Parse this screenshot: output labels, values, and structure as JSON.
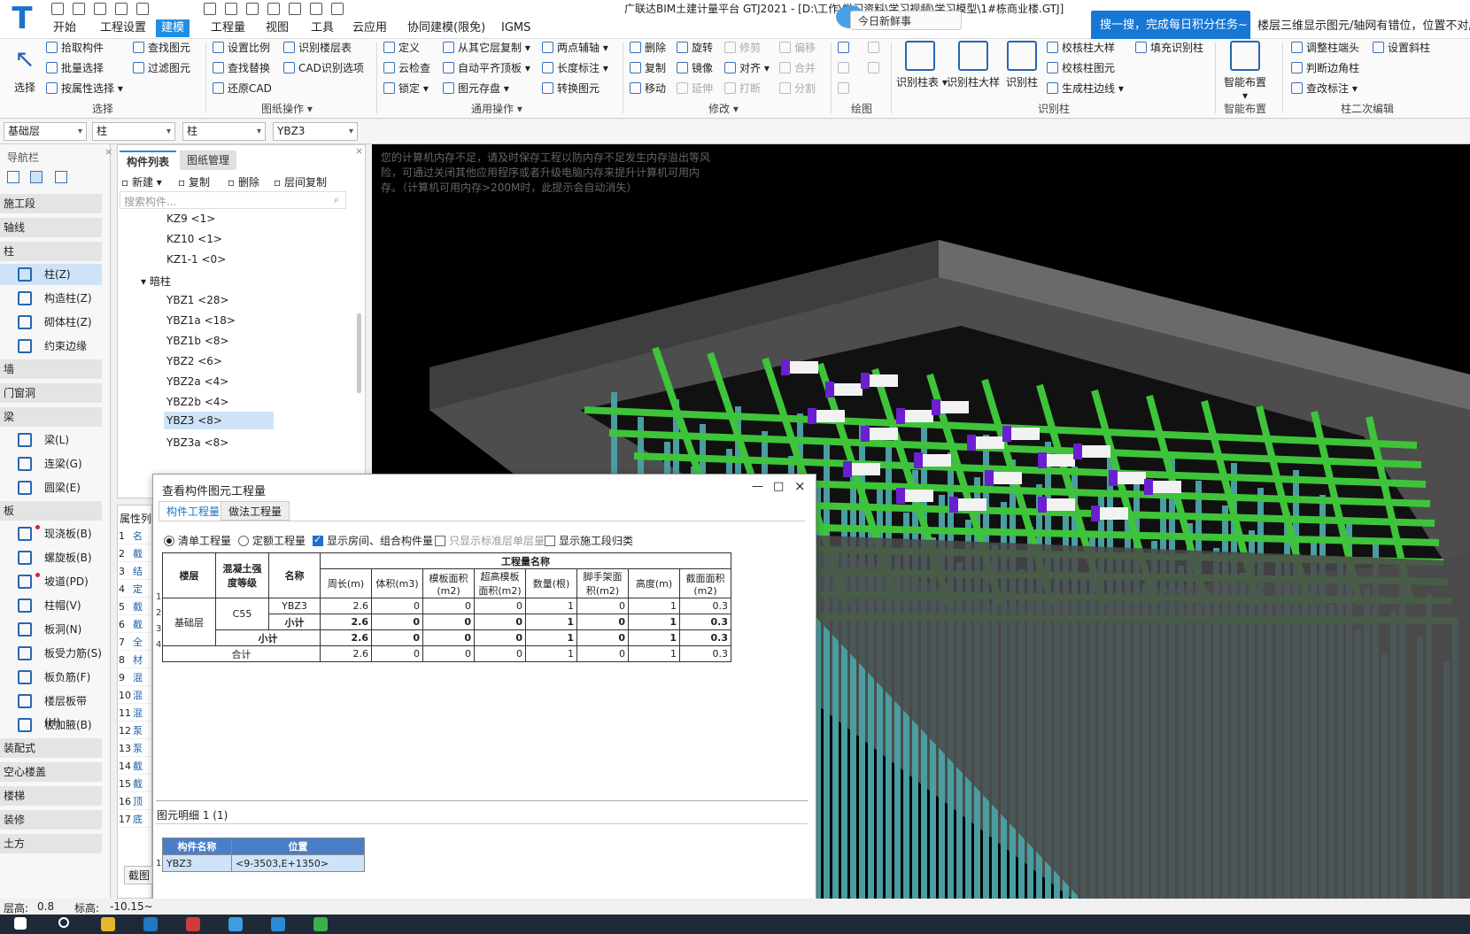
{
  "app": {
    "title": "广联达BIM土建计量平台 GTJ2021 - [D:\\工作\\学习资料\\学习视频\\学习模型\\1#栋商业楼.GTJ]",
    "news": "今日新鲜事",
    "promo": "搜一搜，完成每日积分任务~",
    "promo2": "楼层三维显示图元/轴网有错位，位置不对应"
  },
  "menu": [
    "开始",
    "工程设置",
    "建模",
    "工程量",
    "视图",
    "工具",
    "云应用",
    "协同建模(限免)",
    "IGMS"
  ],
  "ribbon": {
    "select_big": "选择",
    "pick": "拾取构件",
    "batch": "批量选择",
    "by_attr": "按属性选择",
    "find": "查找图元",
    "filter": "过滤图元",
    "group_select": "选择",
    "set_scale": "设置比例",
    "find_replace": "查找替换",
    "restore_cad": "还原CAD",
    "id_floor": "识别楼层表",
    "cad_opt": "CAD识别选项",
    "group_drawing": "图纸操作",
    "define": "定义",
    "cloud_check": "云检查",
    "lock": "锁定",
    "copy_floor": "从其它层复制",
    "auto_slab": "自动平齐顶板",
    "save_elem": "图元存盘",
    "two_axis": "两点辅轴",
    "len_mark": "长度标注",
    "convert": "转换图元",
    "group_common": "通用操作",
    "delete": "删除",
    "copy": "复制",
    "move": "移动",
    "rotate": "旋转",
    "mirror": "镜像",
    "extend": "延伸",
    "trim": "修剪",
    "align": "对齐",
    "break": "打断",
    "offset": "偏移",
    "merge": "合并",
    "split": "分割",
    "group_modify": "修改",
    "group_draw": "绘图",
    "id_col_table": "识别柱表",
    "id_col_big": "识别柱大样",
    "id_col": "识别柱",
    "check_big": "校核柱大样",
    "check_elem": "校核柱图元",
    "gen_edge": "生成柱边线",
    "fill_id": "填充识别柱",
    "group_id": "识别柱",
    "smart": "智能布置",
    "group_smart": "智能布置",
    "adj_head": "调整柱端头",
    "judge_corner": "判断边角柱",
    "check_mark": "查改标注",
    "set_slope": "设置斜柱",
    "group_edit": "柱二次编辑"
  },
  "selectors": [
    "基础层",
    "柱",
    "柱",
    "YBZ3"
  ],
  "nav": {
    "title": "导航栏",
    "cats": [
      "施工段",
      "轴线",
      "柱",
      "墙",
      "门窗洞",
      "梁",
      "板",
      "装配式",
      "空心楼盖",
      "楼梯",
      "装修",
      "土方"
    ],
    "col_items": [
      "柱(Z)",
      "构造柱(Z)",
      "砌体柱(Z)",
      "约束边缘非..."
    ],
    "beam_items": [
      "梁(L)",
      "连梁(G)",
      "圆梁(E)"
    ],
    "slab_items": [
      "现浇板(B)",
      "螺旋板(B)",
      "坡道(PD)",
      "柱帽(V)",
      "板洞(N)",
      "板受力筋(S)",
      "板负筋(F)",
      "楼层板带(H)",
      "板加腋(B)"
    ]
  },
  "component": {
    "tabs": [
      "构件列表",
      "图纸管理"
    ],
    "toolbar": [
      "新建",
      "复制",
      "删除",
      "层间复制"
    ],
    "search": "搜索构件...",
    "items": [
      "KZ9 <1>",
      "KZ10 <1>",
      "KZ1-1 <0>"
    ],
    "group": "暗柱",
    "sub_items": [
      "YBZ1 <28>",
      "YBZ1a <18>",
      "YBZ1b <8>",
      "YBZ2 <6>",
      "YBZ2a <4>",
      "YBZ2b <4>",
      "YBZ3 <8>",
      "YBZ3a <8>"
    ],
    "attr_label": "属性列",
    "attr_rows": [
      "1",
      "2",
      "3",
      "4",
      "5",
      "6",
      "7",
      "8",
      "9",
      "10",
      "11",
      "12",
      "13",
      "14",
      "15",
      "16",
      "17"
    ],
    "attr_chars": [
      "名",
      "截",
      "结",
      "定",
      "截",
      "截",
      "全",
      "材",
      "混",
      "混",
      "混",
      "泵",
      "泵",
      "截",
      "截",
      "顶",
      "底"
    ],
    "attr_btn": "截图"
  },
  "warning": "您的计算机内存不足，请及时保存工程以防内存不足发生内存溢出等风险，可通过关闭其他应用程序或者升级电脑内存来提升计算机可用内存。（计算机可用内存>200M时，此提示会自动消失）",
  "dialog": {
    "title": "查看构件图元工程量",
    "tabs": [
      "构件工程量",
      "做法工程量"
    ],
    "options": [
      "清单工程量",
      "定额工程量",
      "显示房间、组合构件量",
      "只显示标准层单层量",
      "显示施工段归类"
    ],
    "header_group": "工程量名称",
    "headers": [
      "楼层",
      "混凝土强度等级",
      "名称",
      "周长(m)",
      "体积(m3)",
      "模板面积(m2)",
      "超高模板面积(m2)",
      "数量(根)",
      "脚手架面积(m2)",
      "高度(m)",
      "截面面积(m2)"
    ],
    "floor": "基础层",
    "grade": "C55",
    "rows": [
      {
        "name": "YBZ3",
        "v": [
          "2.6",
          "0",
          "0",
          "0",
          "1",
          "0",
          "1",
          "0.3"
        ]
      },
      {
        "name": "小计",
        "v": [
          "2.6",
          "0",
          "0",
          "0",
          "1",
          "0",
          "1",
          "0.3"
        ]
      },
      {
        "name": "小计",
        "v": [
          "2.6",
          "0",
          "0",
          "0",
          "1",
          "0",
          "1",
          "0.3"
        ]
      },
      {
        "name": "合计",
        "v": [
          "2.6",
          "0",
          "0",
          "0",
          "1",
          "0",
          "1",
          "0.3"
        ]
      }
    ],
    "row_nums": [
      "1",
      "2",
      "3",
      "4"
    ],
    "detail_label": "图元明细 1 (1)",
    "detail_headers": [
      "构件名称",
      "位置"
    ],
    "detail_row": {
      "num": "1",
      "name": "YBZ3",
      "pos": "<9-3503,E+1350>"
    }
  },
  "status": {
    "floor_h_label": "层高:",
    "floor_h": "0.8",
    "elev_label": "标高:",
    "elev": "-10.15~"
  },
  "colors": {
    "accent": "#1e8fe1",
    "beam": "#3ec43a",
    "column": "#4a9da0",
    "purple": "#6a1fd0",
    "wall": "#555555"
  }
}
